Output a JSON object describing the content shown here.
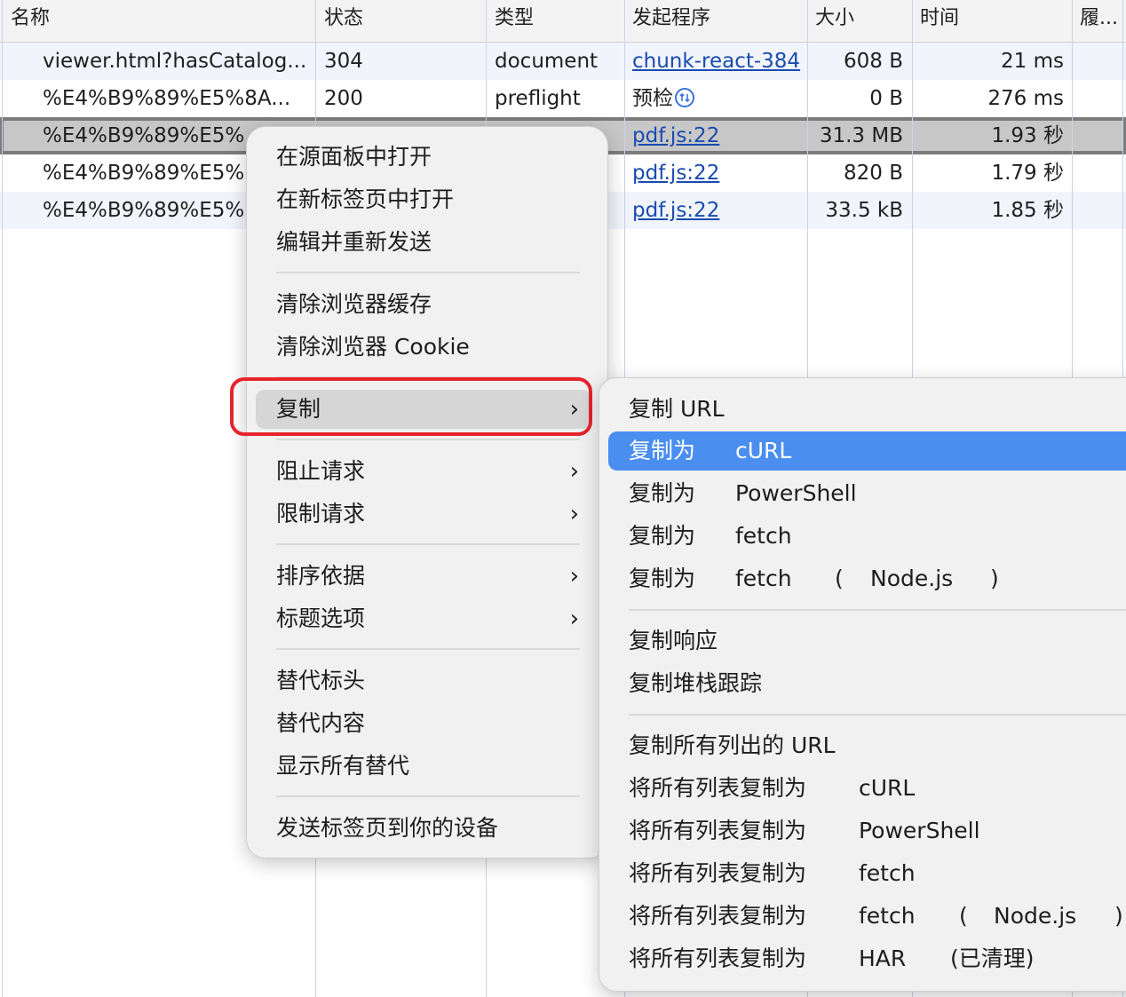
{
  "table": {
    "headers": [
      "名称",
      "状态",
      "类型",
      "发起程序",
      "大小",
      "时间",
      "履..."
    ],
    "rows": [
      {
        "name": "viewer.html?hasCatalog...",
        "status": "304",
        "type": "document",
        "initiator": "chunk-react-384",
        "size": "608 B",
        "time": "21 ms"
      },
      {
        "name": "%E4%B9%89%E5%8A...",
        "status": "200",
        "type": "preflight",
        "initiator": "预检",
        "size": "0 B",
        "time": "276 ms"
      },
      {
        "name": "%E4%B9%89%E5%",
        "status": "",
        "type": "",
        "initiator": "pdf.js:22",
        "size": "31.3 MB",
        "time": "1.93 秒"
      },
      {
        "name": "%E4%B9%89%E5%",
        "status": "",
        "type": "",
        "initiator": "pdf.js:22",
        "size": "820 B",
        "time": "1.79 秒"
      },
      {
        "name": "%E4%B9%89%E5%",
        "status": "",
        "type": "",
        "initiator": "pdf.js:22",
        "size": "33.5 kB",
        "time": "1.85 秒"
      }
    ],
    "selected_row": 2,
    "preflight_icon": "preflight-arrows-icon"
  },
  "context_menu": {
    "groups": [
      [
        "在源面板中打开",
        "在新标签页中打开",
        "编辑并重新发送"
      ],
      [
        "清除浏览器缓存",
        "清除浏览器 Cookie"
      ],
      [
        "复制"
      ],
      [
        "阻止请求",
        "限制请求"
      ],
      [
        "排序依据",
        "标题选项"
      ],
      [
        "替代标头",
        "替代内容",
        "显示所有替代"
      ],
      [
        "发送标签页到你的设备"
      ]
    ],
    "highlighted_item": "复制",
    "highlight_color": "#e5242b"
  },
  "submenu": {
    "copy_url": "复制 URL",
    "copy_as": {
      "prefix": "复制为",
      "items": [
        "cURL",
        "PowerShell",
        "fetch"
      ],
      "node_fetch": [
        "fetch",
        "(",
        "Node.js",
        ")"
      ]
    },
    "copy_response": "复制响应",
    "copy_stack": "复制堆栈跟踪",
    "copy_all_urls": "复制所有列出的 URL",
    "copy_all": {
      "prefix": "将所有列表复制为",
      "items": [
        "cURL",
        "PowerShell",
        "fetch"
      ],
      "node_fetch": [
        "fetch",
        "(",
        "Node.js",
        ")"
      ],
      "har": [
        "HAR",
        "(已清理)"
      ]
    },
    "active_item": "cURL",
    "active_color": "#4a8ef0"
  }
}
